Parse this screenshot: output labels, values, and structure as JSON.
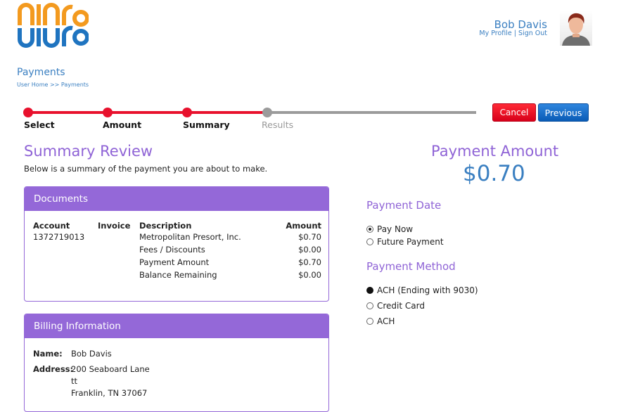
{
  "brand": {
    "logo_text": "uluro",
    "colors": {
      "logo_orange": "#f39a1f",
      "logo_blue": "#1f74c0",
      "accent_purple": "#9468d8",
      "link_blue": "#3a7fc1",
      "step_red": "#e8112d"
    }
  },
  "user": {
    "name": "Bob Davis",
    "profile_link": "My Profile",
    "separator": "|",
    "signout_link": "Sign Out",
    "avatar_icon": "user-avatar-icon"
  },
  "page": {
    "title": "Payments",
    "breadcrumb": {
      "home": "User Home",
      "sep": ">>",
      "current": "Payments"
    }
  },
  "stepper": {
    "steps": [
      {
        "label": "Select",
        "done": true
      },
      {
        "label": "Amount",
        "done": true
      },
      {
        "label": "Summary",
        "done": true
      },
      {
        "label": "Results",
        "done": false
      }
    ]
  },
  "actions": {
    "cancel_label": "Cancel",
    "previous_label": "Previous"
  },
  "summary": {
    "title": "Summary Review",
    "subtitle": "Below is a summary of the payment you are about to make."
  },
  "documents": {
    "title": "Documents",
    "columns": {
      "account": "Account",
      "invoice": "Invoice",
      "description": "Description",
      "amount": "Amount"
    },
    "rows": [
      {
        "account": "1372719013",
        "invoice": "",
        "description": "Metropolitan Presort, Inc.",
        "amount": "$0.70"
      },
      {
        "account": "",
        "invoice": "",
        "description": "Fees / Discounts",
        "amount": "$0.00"
      },
      {
        "account": "",
        "invoice": "",
        "description": "Payment Amount",
        "amount": "$0.70"
      },
      {
        "account": "",
        "invoice": "",
        "description": "Balance Remaining",
        "amount": "$0.00"
      }
    ]
  },
  "billing": {
    "title": "Billing Information",
    "name_label": "Name:",
    "name_value": "Bob Davis",
    "address_label": "Address:",
    "address_line1": "200 Seaboard Lane",
    "address_line2": "tt",
    "address_line3": "Franklin, TN 37067"
  },
  "payment": {
    "amount_title": "Payment Amount",
    "amount_value": "$0.70",
    "date_title": "Payment Date",
    "date_options": [
      {
        "label": "Pay Now",
        "selected": true
      },
      {
        "label": "Future Payment",
        "selected": false
      }
    ],
    "method_title": "Payment Method",
    "method_options": [
      {
        "label": "ACH (Ending with 9030)",
        "selected": true
      },
      {
        "label": "Credit Card",
        "selected": false
      },
      {
        "label": "ACH",
        "selected": false
      }
    ]
  }
}
